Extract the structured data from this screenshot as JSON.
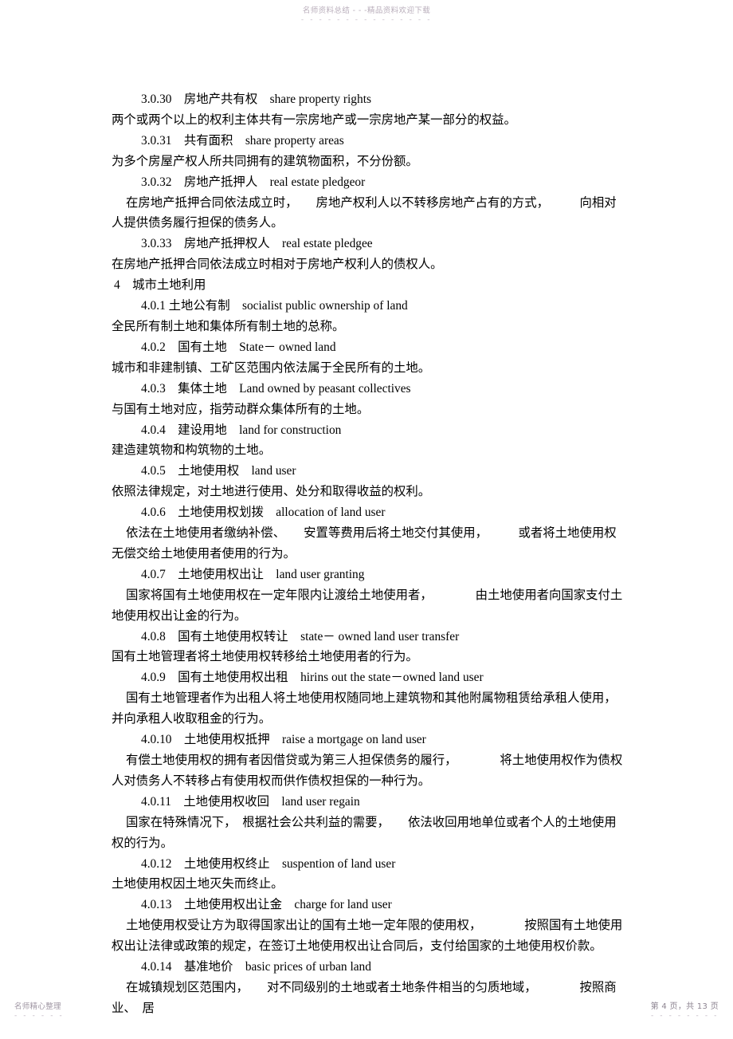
{
  "watermark": {
    "top_text": "名师资料总结 - - -精品资料欢迎下载",
    "top_dashes": "- - - - - - - - - - - - - - -",
    "footer_left": "名师精心整理",
    "footer_left_dashes": "- - - - - -",
    "footer_right": "第 4 页，共 13 页",
    "footer_right_dashes": "- - - - - - - -"
  },
  "lines": [
    {
      "kind": "term",
      "text": "3.0.30　房地产共有权　share property rights"
    },
    {
      "kind": "def",
      "text": "两个或两个以上的权利主体共有一宗房地产或一宗房地产某一部分的权益。"
    },
    {
      "kind": "term",
      "text": "3.0.31　共有面积　share property areas"
    },
    {
      "kind": "def",
      "text": "为多个房屋产权人所共同拥有的建筑物面积，不分份额。"
    },
    {
      "kind": "term",
      "text": "3.0.32　房地产抵押人　real estate pledgeor"
    },
    {
      "kind": "def-indent",
      "text": "在房地产抵押合同依法成立时，　　房地产权利人以不转移房地产占有的方式，　　　向相对人提供债务履行担保的债务人。"
    },
    {
      "kind": "term",
      "text": "3.0.33　房地产抵押权人　real estate pledgee"
    },
    {
      "kind": "def",
      "text": "在房地产抵押合同依法成立时相对于房地产权利人的债权人。"
    },
    {
      "kind": "chapter",
      "text": "4　城市土地利用"
    },
    {
      "kind": "term",
      "text": "4.0.1 土地公有制　socialist public ownership of land"
    },
    {
      "kind": "def",
      "text": "全民所有制土地和集体所有制土地的总称。"
    },
    {
      "kind": "term",
      "text": "4.0.2　国有土地　State－ owned land"
    },
    {
      "kind": "def",
      "text": "城市和非建制镇、工矿区范围内依法属于全民所有的土地。"
    },
    {
      "kind": "term",
      "text": "4.0.3　集体土地　Land owned by peasant collectives"
    },
    {
      "kind": "def",
      "text": "与国有土地对应，指劳动群众集体所有的土地。"
    },
    {
      "kind": "term",
      "text": "4.0.4　建设用地　land for construction"
    },
    {
      "kind": "def",
      "text": "建造建筑物和构筑物的土地。"
    },
    {
      "kind": "term",
      "text": "4.0.5　土地使用权　land user"
    },
    {
      "kind": "def",
      "text": "依照法律规定，对土地进行使用、处分和取得收益的权利。"
    },
    {
      "kind": "term",
      "text": "4.0.6　土地使用权划拨　allocation of land user"
    },
    {
      "kind": "def-indent",
      "text": "依法在土地使用者缴纳补偿、　　安置等费用后将土地交付其使用，　　　或者将土地使用权无偿交给土地使用者使用的行为。"
    },
    {
      "kind": "term",
      "text": "4.0.7　土地使用权出让　land user granting"
    },
    {
      "kind": "def-indent",
      "text": "国家将国有土地使用权在一定年限内让渡给土地使用者，　　　　由土地使用者向国家支付土地使用权出让金的行为。"
    },
    {
      "kind": "term",
      "text": "4.0.8　国有土地使用权转让　state－ owned land user transfer"
    },
    {
      "kind": "def",
      "text": "国有土地管理者将土地使用权转移给土地使用者的行为。"
    },
    {
      "kind": "term",
      "text": "4.0.9　国有土地使用权出租　hirins out the state－owned land user"
    },
    {
      "kind": "def-indent",
      "text": "国有土地管理者作为出租人将土地使用权随同地上建筑物和其他附属物租赁给承租人使用，并向承租人收取租金的行为。"
    },
    {
      "kind": "term",
      "text": "4.0.10　土地使用权抵押　raise a mortgage on land user"
    },
    {
      "kind": "def-indent",
      "text": "有偿土地使用权的拥有者因借贷或为第三人担保债务的履行，　　　　将土地使用权作为债权人对债务人不转移占有使用权而供作债权担保的一种行为。"
    },
    {
      "kind": "term",
      "text": "4.0.11　土地使用权收回　land user regain"
    },
    {
      "kind": "def-indent",
      "text": "国家在特殊情况下，　根据社会公共利益的需要，　　依法收回用地单位或者个人的土地使用权的行为。"
    },
    {
      "kind": "term",
      "text": "4.0.12　土地使用权终止　suspention of land user"
    },
    {
      "kind": "def",
      "text": "土地使用权因土地灭失而终止。"
    },
    {
      "kind": "term",
      "text": "4.0.13　土地使用权出让金　charge for land user"
    },
    {
      "kind": "def-indent",
      "text": "土地使用权受让方为取得国家出让的国有土地一定年限的使用权，　　　　按照国有土地使用权出让法律或政策的规定，在签订土地使用权出让合同后，支付给国家的土地使用权价款。"
    },
    {
      "kind": "term",
      "text": "4.0.14　基准地价　basic prices of urban land"
    },
    {
      "kind": "def-indent",
      "text": "在城镇规划区范围内，　　对不同级别的土地或者土地条件相当的匀质地域，　　　　按照商业、　居"
    }
  ]
}
